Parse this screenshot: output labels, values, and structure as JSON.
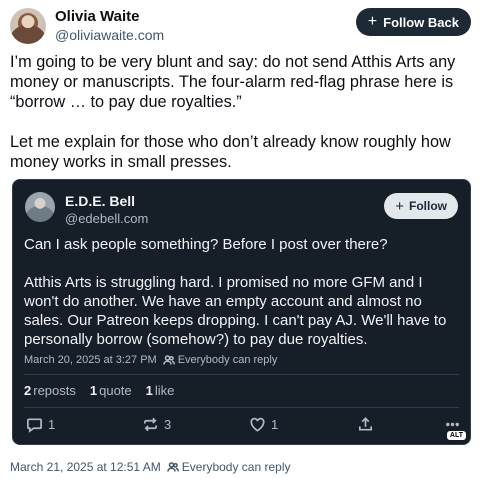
{
  "post": {
    "author_name": "Olivia Waite",
    "author_handle": "@oliviawaite.com",
    "follow_label": "Follow Back",
    "paragraphs": [
      "I’m going to be very blunt and say: do not send Atthis Arts any money or manuscripts. The four-alarm red-flag phrase here is “borrow … to pay due royalties.”",
      "Let me explain for those who don’t already know roughly how money works in small presses."
    ],
    "timestamp": "March 21, 2025 at 12:51 AM",
    "reply_setting": "Everybody can reply"
  },
  "quote": {
    "author_name": "E.D.E. Bell",
    "author_handle": "@edebell.com",
    "follow_label": "Follow",
    "paragraphs": [
      "Can I ask people something? Before I post over there?",
      "Atthis Arts is struggling hard. I promised no more GFM and I won't do another. We have an empty account and almost no sales. Our Patreon keeps dropping. I can't pay AJ. We'll have to personally borrow (somehow?) to pay due royalties."
    ],
    "timestamp": "March 20, 2025 at 3:27 PM",
    "reply_setting": "Everybody can reply",
    "stats": {
      "reposts_count": "2",
      "reposts_label": "reposts",
      "quotes_count": "1",
      "quotes_label": "quote",
      "likes_count": "1",
      "likes_label": "like"
    },
    "actions": {
      "reply_count": "1",
      "repost_count": "3",
      "like_count": "1"
    },
    "alt_badge": "ALT"
  },
  "icons": {
    "follow": "plus-icon",
    "people": "people-icon",
    "reply": "comment-icon",
    "repost": "repost-icon",
    "like": "heart-icon",
    "share": "share-icon",
    "more": "ellipsis-icon"
  },
  "colors": {
    "follow_back_bg": "#1e2936",
    "quote_bg": "#161e27",
    "muted_text": "#42576c"
  }
}
